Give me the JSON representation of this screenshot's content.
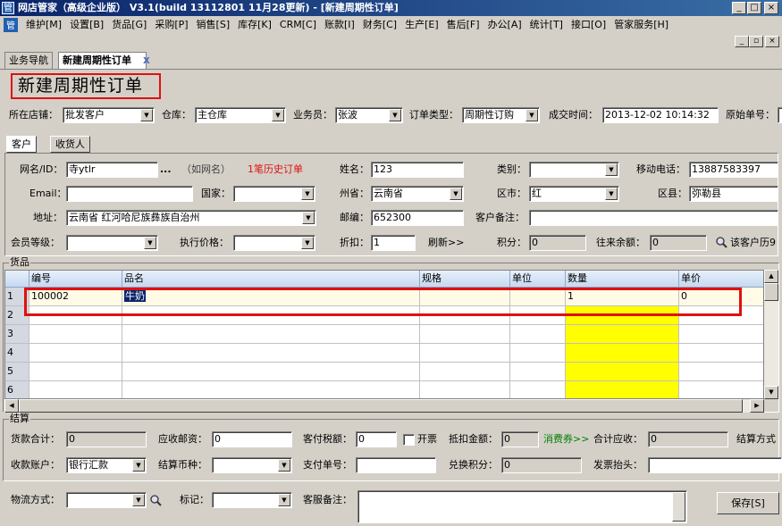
{
  "window": {
    "title": "网店管家（高级企业版） V3.1(build 13112801 11月28更新) - [新建周期性订单]"
  },
  "menu": [
    "维护[M]",
    "设置[B]",
    "货品[G]",
    "采购[P]",
    "销售[S]",
    "库存[K]",
    "CRM[C]",
    "账款[I]",
    "财务[C]",
    "生产[E]",
    "售后[F]",
    "办公[A]",
    "统计[T]",
    "接口[O]",
    "管家服务[H]"
  ],
  "tabs": [
    "业务导航",
    "新建周期性订单"
  ],
  "page_title": "新建周期性订单",
  "header": {
    "store_label": "所在店铺：",
    "store_value": "批发客户",
    "warehouse_label": "仓库：",
    "warehouse_value": "主仓库",
    "salesman_label": "业务员：",
    "salesman_value": "张波",
    "order_type_label": "订单类型：",
    "order_type_value": "周期性订购",
    "deal_time_label": "成交时间：",
    "deal_time_value": "2013-12-02 10:14:32",
    "orig_no_label": "原始单号："
  },
  "subtabs": [
    "客户",
    "收货人"
  ],
  "customer": {
    "netname_label": "网名/ID：",
    "netname_value": "寺ytlr",
    "netname_dots": "...",
    "netname_hint": "（如网名）",
    "history_link": "1笔历史订单",
    "name_label": "姓名：",
    "name_value": "123",
    "category_label": "类别：",
    "category_value": "",
    "mobile_label": "移动电话：",
    "mobile_value": "13887583397",
    "email_label": "Email：",
    "email_value": "",
    "country_label": "国家：",
    "country_value": "",
    "province_label": "州省：",
    "province_value": "云南省",
    "city_label": "区市：",
    "city_value": "红",
    "district_label": "区县：",
    "district_value": "弥勒县",
    "address_label": "地址：",
    "address_value": "云南省 红河哈尼族彝族自治州",
    "zip_label": "邮编：",
    "zip_value": "652300",
    "remark_label": "客户备注：",
    "remark_value": "",
    "level_label": "会员等级：",
    "level_value": "",
    "price_label": "执行价格：",
    "price_value": "",
    "discount_label": "折扣：",
    "discount_value": "1",
    "refresh_label": "刷新>>",
    "points_label": "积分：",
    "points_value": "0",
    "balance_label": "往来余额：",
    "balance_value": "0",
    "history_label": "该客户历9"
  },
  "goods": {
    "group_label": "货品",
    "columns": [
      "编号",
      "品名",
      "规格",
      "单位",
      "数量",
      "单价"
    ],
    "rows": [
      {
        "num": "1",
        "code": "100002",
        "name": "牛奶",
        "spec": "",
        "unit": "",
        "qty": "1",
        "price": "0"
      },
      {
        "num": "2",
        "code": "",
        "name": "",
        "spec": "",
        "unit": "",
        "qty": "",
        "price": ""
      },
      {
        "num": "3",
        "code": "",
        "name": "",
        "spec": "",
        "unit": "",
        "qty": "",
        "price": ""
      },
      {
        "num": "4",
        "code": "",
        "name": "",
        "spec": "",
        "unit": "",
        "qty": "",
        "price": ""
      },
      {
        "num": "5",
        "code": "",
        "name": "",
        "spec": "",
        "unit": "",
        "qty": "",
        "price": ""
      },
      {
        "num": "6",
        "code": "",
        "name": "",
        "spec": "",
        "unit": "",
        "qty": "",
        "price": ""
      }
    ]
  },
  "settle": {
    "group_label": "结算",
    "goods_total_label": "货款合计：",
    "goods_total_value": "0",
    "postage_label": "应收邮资：",
    "postage_value": "0",
    "tax_label": "客付税额：",
    "tax_value": "0",
    "invoice_label": "开票",
    "deduct_label": "抵扣金额：",
    "deduct_value": "0",
    "coupon_label": "消费券>>",
    "receivable_label": "合计应收：",
    "receivable_value": "0",
    "settle_method_label": "结算方式",
    "account_label": "收款账户：",
    "account_value": "银行汇款",
    "currency_label": "结算币种：",
    "currency_value": "",
    "payno_label": "支付单号：",
    "payno_value": "",
    "exchange_label": "兑换积分：",
    "exchange_value": "0",
    "invoice_title_label": "发票抬头：",
    "invoice_title_value": ""
  },
  "footer": {
    "logistics_label": "物流方式：",
    "logistics_value": "",
    "mark_label": "标记：",
    "mark_value": "",
    "cs_remark_label": "客服备注：",
    "cs_remark_value": "",
    "save_label": "保存[S]"
  }
}
